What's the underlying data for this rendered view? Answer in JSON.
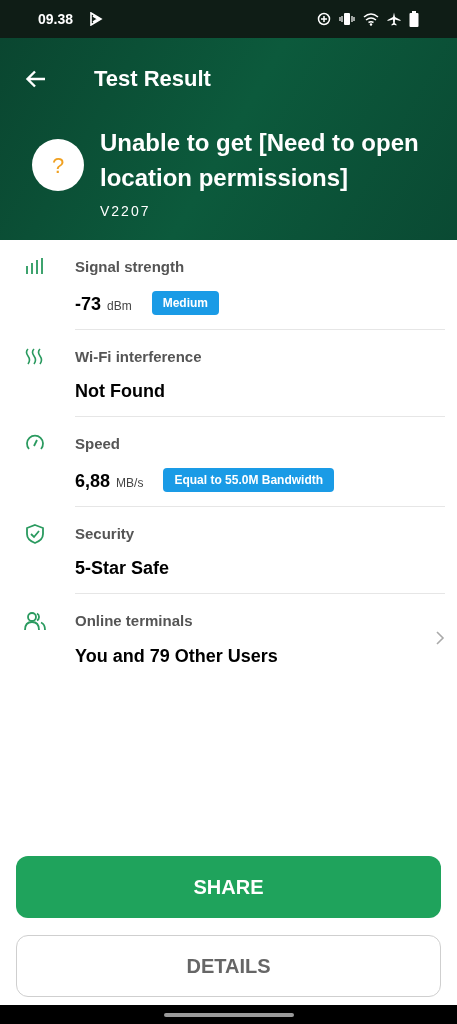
{
  "status_bar": {
    "time": "09.38"
  },
  "header": {
    "title": "Test Result",
    "status_icon": "?",
    "headline": "Unable to get [Need to open location permissions]",
    "subtitle": "V2207"
  },
  "items": [
    {
      "kind": "signal",
      "label": "Signal strength",
      "value": "-73",
      "unit": "dBm",
      "badge": "Medium",
      "navigable": false
    },
    {
      "kind": "interference",
      "label": "Wi-Fi interference",
      "value": "Not Found",
      "navigable": false
    },
    {
      "kind": "speed",
      "label": "Speed",
      "value": "6,88",
      "unit": "MB/s",
      "badge": "Equal to 55.0M Bandwidth",
      "navigable": false
    },
    {
      "kind": "security",
      "label": "Security",
      "value": "5-Star Safe",
      "navigable": false
    },
    {
      "kind": "users",
      "label": "Online terminals",
      "value": "You and  79 Other Users",
      "navigable": true
    }
  ],
  "buttons": [
    {
      "label": "SHARE",
      "kind": "primary"
    },
    {
      "label": "DETAILS",
      "kind": "secondary"
    }
  ]
}
